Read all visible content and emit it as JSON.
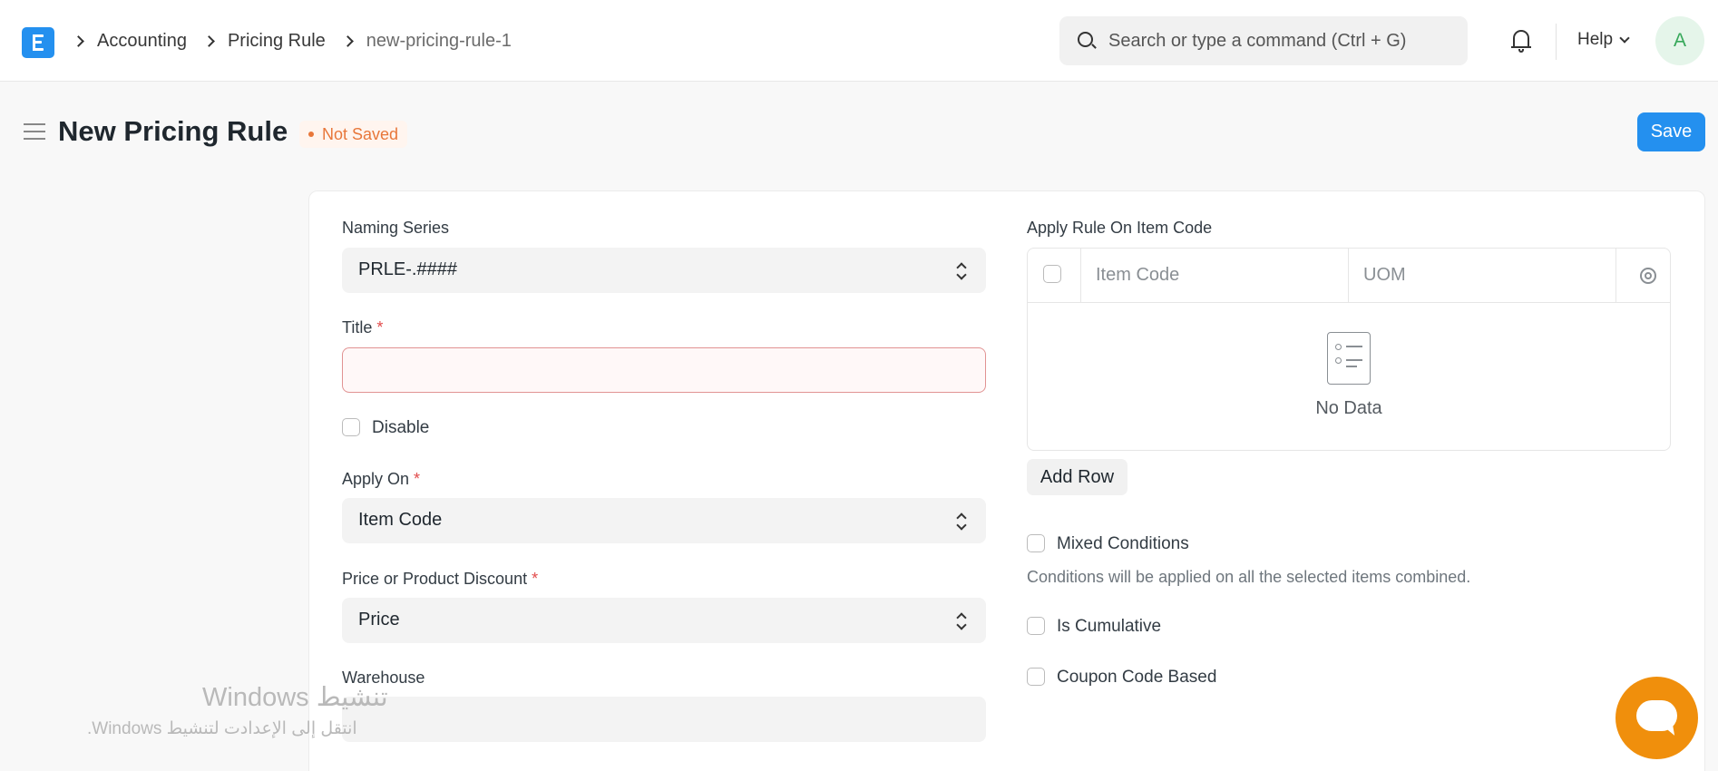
{
  "navbar": {
    "breadcrumbs": [
      "Accounting",
      "Pricing Rule",
      "new-pricing-rule-1"
    ],
    "search_placeholder": "Search or type a command (Ctrl + G)",
    "help_label": "Help",
    "avatar_initial": "A"
  },
  "page": {
    "title": "New Pricing Rule",
    "status": "Not Saved",
    "save_label": "Save"
  },
  "form": {
    "naming_series": {
      "label": "Naming Series",
      "value": "PRLE-.####"
    },
    "title": {
      "label": "Title",
      "required": "*",
      "value": ""
    },
    "disable": {
      "label": "Disable",
      "checked": false
    },
    "apply_on": {
      "label": "Apply On",
      "required": "*",
      "value": "Item Code"
    },
    "price_or_discount": {
      "label": "Price or Product Discount",
      "required": "*",
      "value": "Price"
    },
    "warehouse": {
      "label": "Warehouse",
      "value": ""
    },
    "apply_rule_table": {
      "label": "Apply Rule On Item Code",
      "columns": [
        "Item Code",
        "UOM"
      ],
      "empty_text": "No Data",
      "add_row_label": "Add Row"
    },
    "mixed_conditions": {
      "label": "Mixed Conditions",
      "checked": false,
      "description": "Conditions will be applied on all the selected items combined."
    },
    "is_cumulative": {
      "label": "Is Cumulative",
      "checked": false
    },
    "coupon_code_based": {
      "label": "Coupon Code Based",
      "checked": false
    }
  },
  "watermark": {
    "line1": "تنشيط Windows",
    "line2": "انتقل إلى الإعدادت لتنشيط Windows."
  },
  "colors": {
    "primary": "#2490ef",
    "status_orange": "#e8773a",
    "chat": "#f08f0c",
    "required": "#e24c4c"
  }
}
